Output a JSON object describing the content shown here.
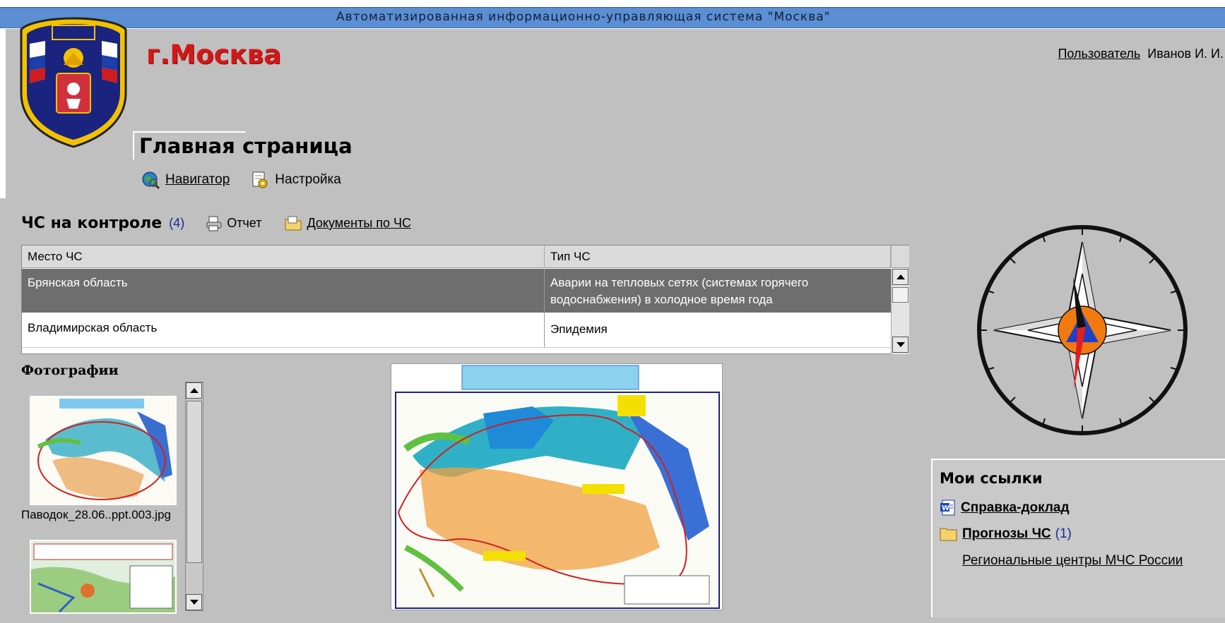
{
  "header": {
    "system_title": "Автоматизированная информационно-управляющая система \"Москва\"",
    "city": "г.Москва",
    "user_label": "Пользователь",
    "user_name": "Иванов И. И.",
    "page_title": "Главная страница"
  },
  "nav": {
    "navigator": "Навигатор",
    "settings": "Настройка"
  },
  "emergencies": {
    "title": "ЧС на контроле",
    "count": "(4)",
    "report": "Отчет",
    "documents": "Документы по ЧС",
    "columns": [
      "Место ЧС",
      "Тип ЧС"
    ],
    "rows": [
      {
        "place": "Брянская область",
        "type": "Аварии на тепловых сетях (системах горячего водоснабжения) в холодное время года"
      },
      {
        "place": "Владимирская область",
        "type": "Эпидемия"
      }
    ]
  },
  "photos": {
    "title": "Фотографии",
    "items": [
      {
        "caption": "Паводок_28.06..ppt.003.jpg"
      }
    ]
  },
  "links": {
    "title": "Мои ссылки",
    "items": [
      {
        "label": "Справка-доклад",
        "icon": "word-doc-icon"
      },
      {
        "label": "Прогнозы ЧС",
        "count": "(1)",
        "icon": "folder-icon"
      },
      {
        "label": "Региональные центры МЧС России"
      }
    ]
  },
  "colors": {
    "title_bar": "#5b8ed2",
    "page_bg": "#c0c0c0",
    "city_red": "#d11818",
    "selected_row": "#6e6e6e"
  }
}
